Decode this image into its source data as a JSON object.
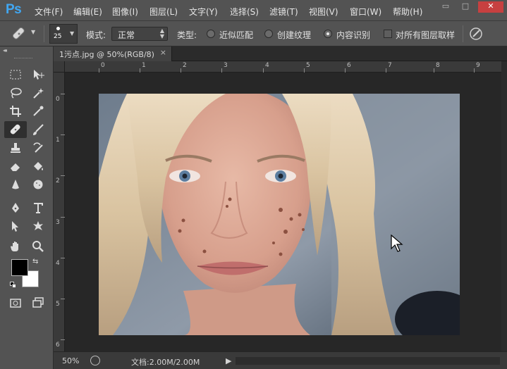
{
  "app": {
    "logo": "Ps"
  },
  "menu": {
    "items": [
      "文件(F)",
      "编辑(E)",
      "图像(I)",
      "图层(L)",
      "文字(Y)",
      "选择(S)",
      "滤镜(T)",
      "视图(V)",
      "窗口(W)",
      "帮助(H)"
    ]
  },
  "window_controls": {
    "minimize": "▭",
    "maximize": "□",
    "close": "✕"
  },
  "options": {
    "brush_size": "25",
    "mode_label": "模式:",
    "mode_value": "正常",
    "type_label": "类型:",
    "type_options": [
      {
        "label": "近似匹配",
        "selected": false
      },
      {
        "label": "创建纹理",
        "selected": false
      },
      {
        "label": "内容识别",
        "selected": true
      }
    ],
    "sample_all_layers_label": "对所有图层取样",
    "sample_all_layers_checked": false
  },
  "toolbar": {
    "collapse_glyph": "◂◂",
    "tools": [
      "marquee-tool",
      "move-tool",
      "lasso-tool",
      "magic-wand-tool",
      "crop-tool",
      "eyedropper-tool",
      "spot-healing-brush-tool",
      "brush-tool",
      "clone-stamp-tool",
      "history-brush-tool",
      "eraser-tool",
      "paint-bucket-tool",
      "blur-tool",
      "dodge-tool",
      "pen-tool",
      "type-tool",
      "path-selection-tool",
      "custom-shape-tool",
      "hand-tool",
      "zoom-tool"
    ],
    "active_tool": "spot-healing-brush-tool",
    "foreground_color": "#000000",
    "background_color": "#ffffff"
  },
  "document": {
    "tab_title": "1污点.jpg @ 50%(RGB/8)",
    "tab_close": "×"
  },
  "rulers": {
    "horizontal": [
      "0",
      "1",
      "2",
      "3",
      "4",
      "5",
      "6",
      "7",
      "8",
      "9"
    ],
    "vertical": [
      "0",
      "1",
      "2",
      "3",
      "4",
      "5",
      "6"
    ]
  },
  "status": {
    "zoom": "50%",
    "doc_size": "文档:2.00M/2.00M",
    "arrow": "▶"
  },
  "colors": {
    "ui_panel": "#535353",
    "canvas_bg": "#272727",
    "logo_blue": "#41a7f2"
  }
}
